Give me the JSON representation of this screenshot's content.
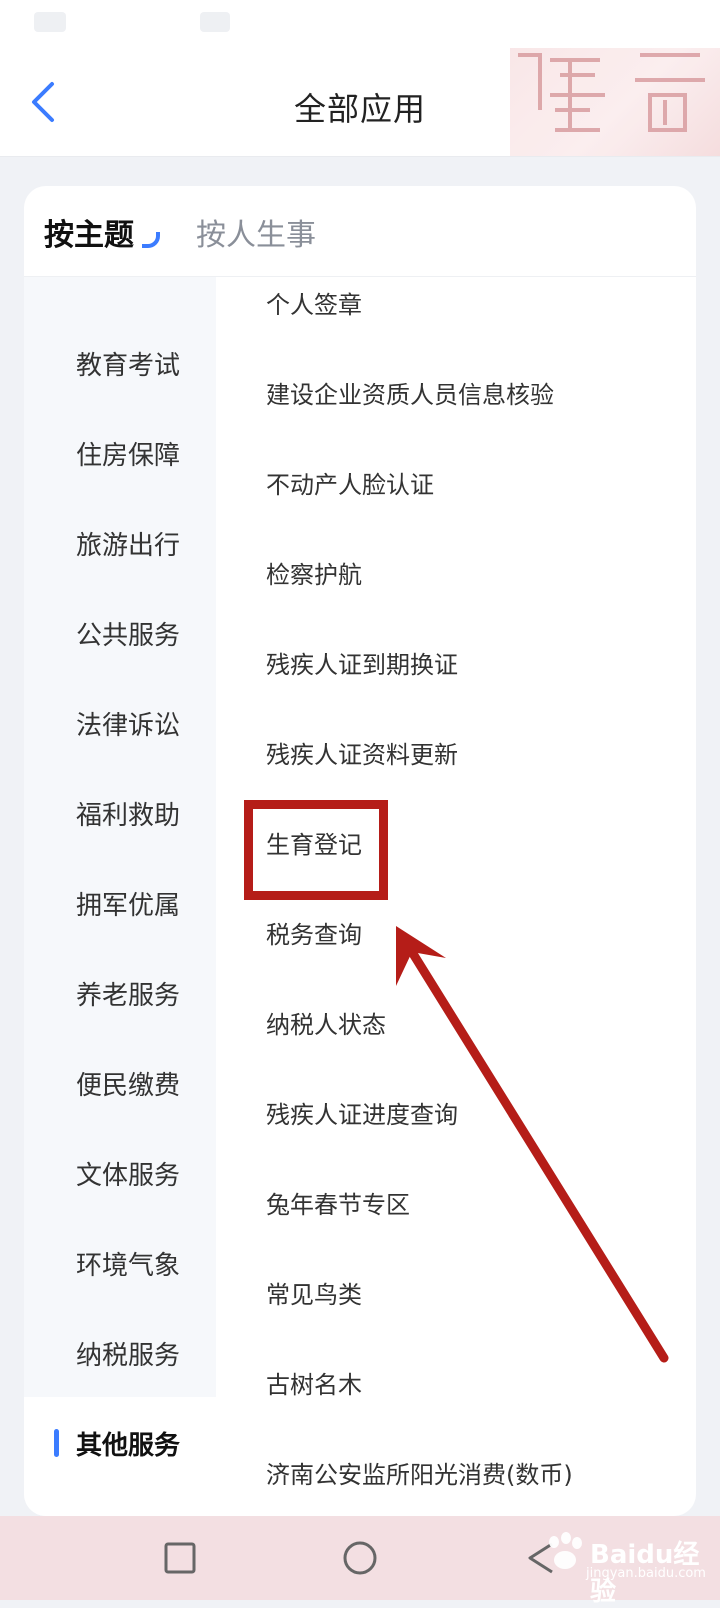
{
  "header": {
    "title": "全部应用"
  },
  "tabs": [
    {
      "label": "按主题",
      "active": true
    },
    {
      "label": "按人生事",
      "active": false
    }
  ],
  "sidebar": {
    "items": [
      {
        "label": "教育考试"
      },
      {
        "label": "住房保障"
      },
      {
        "label": "旅游出行"
      },
      {
        "label": "公共服务"
      },
      {
        "label": "法律诉讼"
      },
      {
        "label": "福利救助"
      },
      {
        "label": "拥军优属"
      },
      {
        "label": "养老服务"
      },
      {
        "label": "便民缴费"
      },
      {
        "label": "文体服务"
      },
      {
        "label": "环境气象"
      },
      {
        "label": "纳税服务"
      },
      {
        "label": "其他服务",
        "active": true
      }
    ]
  },
  "apps": [
    {
      "label": "个人签章"
    },
    {
      "label": "建设企业资质人员信息核验"
    },
    {
      "label": "不动产人脸认证"
    },
    {
      "label": "检察护航"
    },
    {
      "label": "残疾人证到期换证"
    },
    {
      "label": "残疾人证资料更新"
    },
    {
      "label": "生育登记"
    },
    {
      "label": "税务查询"
    },
    {
      "label": "纳税人状态"
    },
    {
      "label": "残疾人证进度查询"
    },
    {
      "label": "兔年春节专区"
    },
    {
      "label": "常见鸟类"
    },
    {
      "label": "古树名木"
    },
    {
      "label": "济南公安监所阳光消费(数币)"
    }
  ],
  "watermark": {
    "brand": "Baidu经验",
    "url": "jingyan.baidu.com"
  },
  "colors": {
    "accent": "#3b7cff",
    "annotation": "#b51d18",
    "navbar": "#f3dfe2"
  }
}
